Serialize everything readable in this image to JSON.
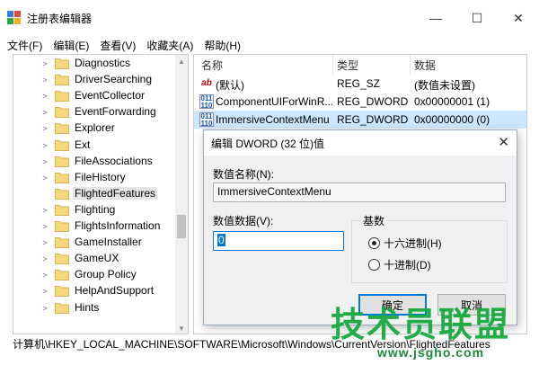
{
  "window": {
    "title": "注册表编辑器",
    "controls": {
      "minimize": "—",
      "maximize": "☐",
      "close": "✕"
    }
  },
  "menu": [
    "文件(F)",
    "编辑(E)",
    "查看(V)",
    "收藏夹(A)",
    "帮助(H)"
  ],
  "tree": {
    "items": [
      {
        "label": "Diagnostics",
        "arrow": ">"
      },
      {
        "label": "DriverSearching",
        "arrow": ">"
      },
      {
        "label": "EventCollector",
        "arrow": ">"
      },
      {
        "label": "EventForwarding",
        "arrow": ">"
      },
      {
        "label": "Explorer",
        "arrow": ">"
      },
      {
        "label": "Ext",
        "arrow": ">"
      },
      {
        "label": "FileAssociations",
        "arrow": ">"
      },
      {
        "label": "FileHistory",
        "arrow": ">"
      },
      {
        "label": "FlightedFeatures",
        "arrow": "",
        "selected": true
      },
      {
        "label": "Flighting",
        "arrow": ">"
      },
      {
        "label": "FlightsInformation",
        "arrow": ">"
      },
      {
        "label": "GameInstaller",
        "arrow": ">"
      },
      {
        "label": "GameUX",
        "arrow": ">"
      },
      {
        "label": "Group Policy",
        "arrow": ">"
      },
      {
        "label": "HelpAndSupport",
        "arrow": ">"
      },
      {
        "label": "Hints",
        "arrow": ">"
      }
    ]
  },
  "list": {
    "headers": {
      "name": "名称",
      "type": "类型",
      "data": "数据"
    },
    "rows": [
      {
        "icon": "ab",
        "name": "(默认)",
        "type": "REG_SZ",
        "data": "(数值未设置)"
      },
      {
        "icon": "bin",
        "name": "ComponentUIForWinR...",
        "type": "REG_DWORD",
        "data": "0x00000001 (1)"
      },
      {
        "icon": "bin",
        "name": "ImmersiveContextMenu",
        "type": "REG_DWORD",
        "data": "0x00000000 (0)",
        "selected": true
      }
    ]
  },
  "statusbar": {
    "path": "计算机\\HKEY_LOCAL_MACHINE\\SOFTWARE\\Microsoft\\Windows\\CurrentVersion\\FlightedFeatures"
  },
  "dialog": {
    "title": "编辑 DWORD (32 位)值",
    "close": "✕",
    "name_label": "数值名称(N):",
    "name_value": "ImmersiveContextMenu",
    "data_label": "数值数据(V):",
    "data_value": "0",
    "base_label": "基数",
    "radio_hex": "十六进制(H)",
    "radio_dec": "十进制(D)",
    "ok": "确定",
    "cancel": "取消"
  },
  "watermark": {
    "text": "技术员联盟",
    "url": "www.jsgho.com"
  },
  "colors": {
    "selection": "#cce8ff",
    "accent": "#0078d7",
    "folder": "#f5d77e"
  }
}
